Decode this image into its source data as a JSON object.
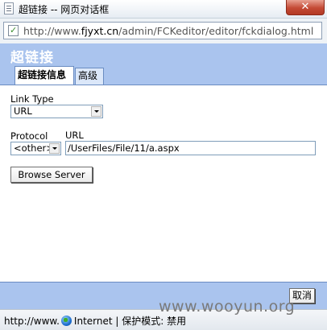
{
  "window": {
    "title": "超链接 -- 网页对话框",
    "close_glyph": "✕"
  },
  "address": {
    "prefix": "http://www.",
    "domain": "fjyxt.cn",
    "path": "/admin/FCKeditor/editor/fckdialog.html",
    "icon": "page-icon"
  },
  "dialog": {
    "heading": "超链接",
    "tabs": [
      {
        "label": "超链接信息",
        "active": true
      },
      {
        "label": "高级",
        "active": false
      }
    ]
  },
  "form": {
    "link_type_label": "Link Type",
    "link_type_value": "URL",
    "protocol_label": "Protocol",
    "protocol_value": "<other>",
    "url_label": "URL",
    "url_value": "/UserFiles/File/11/a.aspx",
    "browse_button": "Browse Server"
  },
  "footer": {
    "cancel_button": "取消"
  },
  "status": {
    "url_text": "http://www.",
    "zone_text": "Internet | 保护模式: 禁用",
    "icon": "globe-icon"
  },
  "watermark": "www.wooyun.org",
  "colors": {
    "dialog_blue": "#aac4ee",
    "close_red": "#c44a35"
  }
}
